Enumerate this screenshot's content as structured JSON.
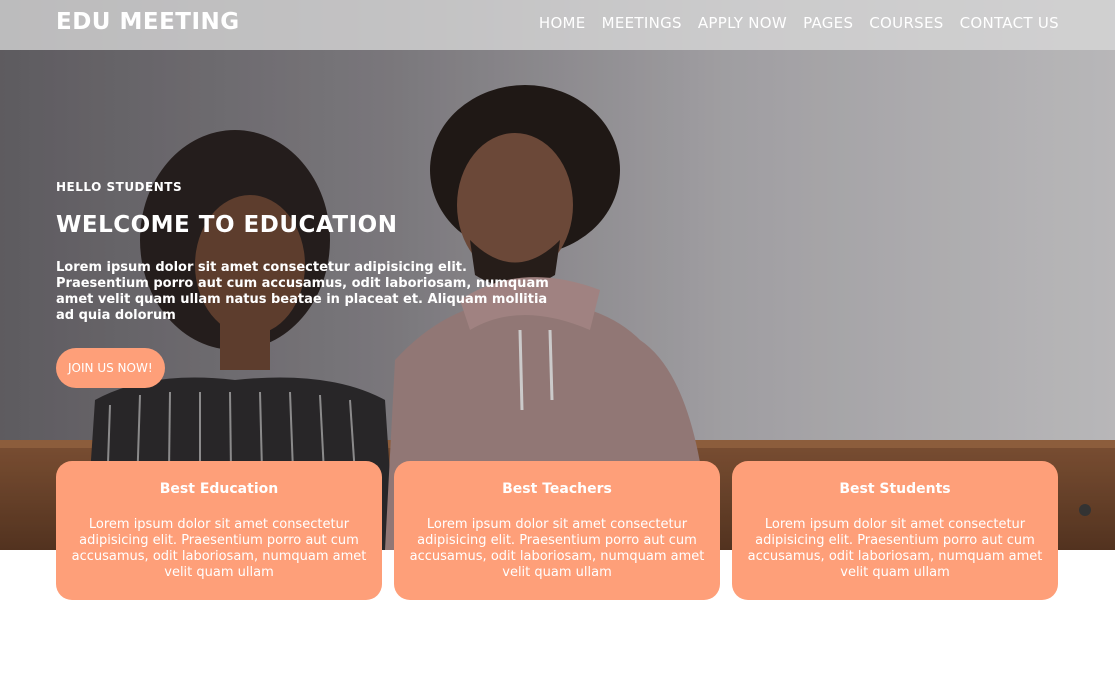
{
  "brand": "EDU MEETING",
  "nav": {
    "items": [
      "HOME",
      "MEETINGS",
      "APPLY NOW",
      "PAGES",
      "COURSES",
      "CONTACT US"
    ]
  },
  "hero": {
    "eyebrow": "HELLO STUDENTS",
    "headline": "WELCOME TO EDUCATION",
    "lead": "Lorem ipsum dolor sit amet consectetur adipisicing elit. Praesentium porro aut cum accusamus, odit laboriosam, numquam amet velit quam ullam natus beatae in placeat et. Aliquam mollitia ad quia dolorum",
    "cta_label": "JOIN US NOW!"
  },
  "features": [
    {
      "title": "Best Education",
      "text": "Lorem ipsum dolor sit amet consectetur adipisicing elit. Praesentium porro aut cum accusamus, odit laboriosam, numquam amet velit quam ullam"
    },
    {
      "title": "Best Teachers",
      "text": "Lorem ipsum dolor sit amet consectetur adipisicing elit. Praesentium porro aut cum accusamus, odit laboriosam, numquam amet velit quam ullam"
    },
    {
      "title": "Best Students",
      "text": "Lorem ipsum dolor sit amet consectetur adipisicing elit. Praesentium porro aut cum accusamus, odit laboriosam, numquam amet velit quam ullam"
    }
  ],
  "colors": {
    "accent": "#fe9f79",
    "navbar": "#d7d7d7",
    "text_on_dark": "#ffffff"
  }
}
